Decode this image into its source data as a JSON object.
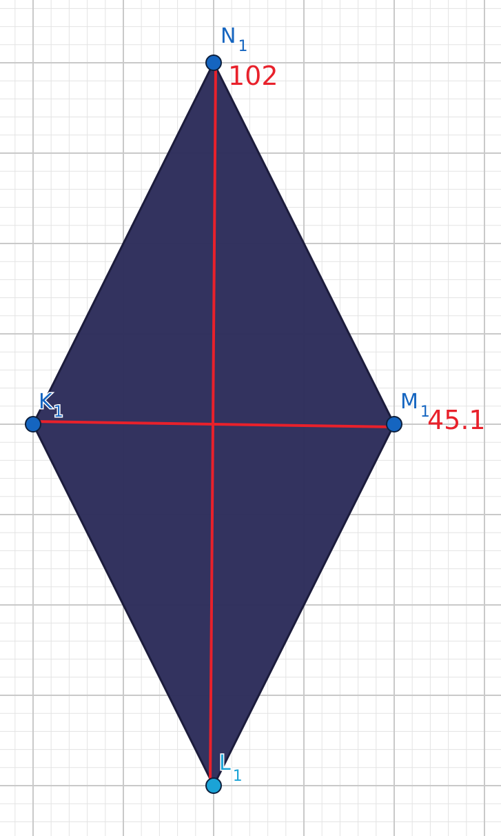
{
  "colors": {
    "background": "#ffffff",
    "grid_minor": "#e3e3e3",
    "grid_major": "#c9c9c9",
    "rhombus_fill": "#2f2f5c",
    "rhombus_stroke": "#1c1c3c",
    "diagonal": "#e8212b",
    "point_blue": "#1565c0",
    "point_cyan": "#1ba3d6",
    "label_blue": "#1565c0",
    "label_cyan": "#1ba3d6",
    "measure_text": "#e8212b"
  },
  "points": [
    {
      "id": "N1",
      "letter": "N",
      "sub": "1",
      "color": "#1565c0"
    },
    {
      "id": "K1",
      "letter": "K",
      "sub": "1",
      "color": "#1565c0"
    },
    {
      "id": "M1",
      "letter": "M",
      "sub": "1",
      "color": "#1565c0"
    },
    {
      "id": "L1",
      "letter": "L",
      "sub": "1",
      "color": "#1ba3d6"
    }
  ],
  "measurements": {
    "vertical_diagonal": "102",
    "horizontal_diagonal": "45.1"
  }
}
